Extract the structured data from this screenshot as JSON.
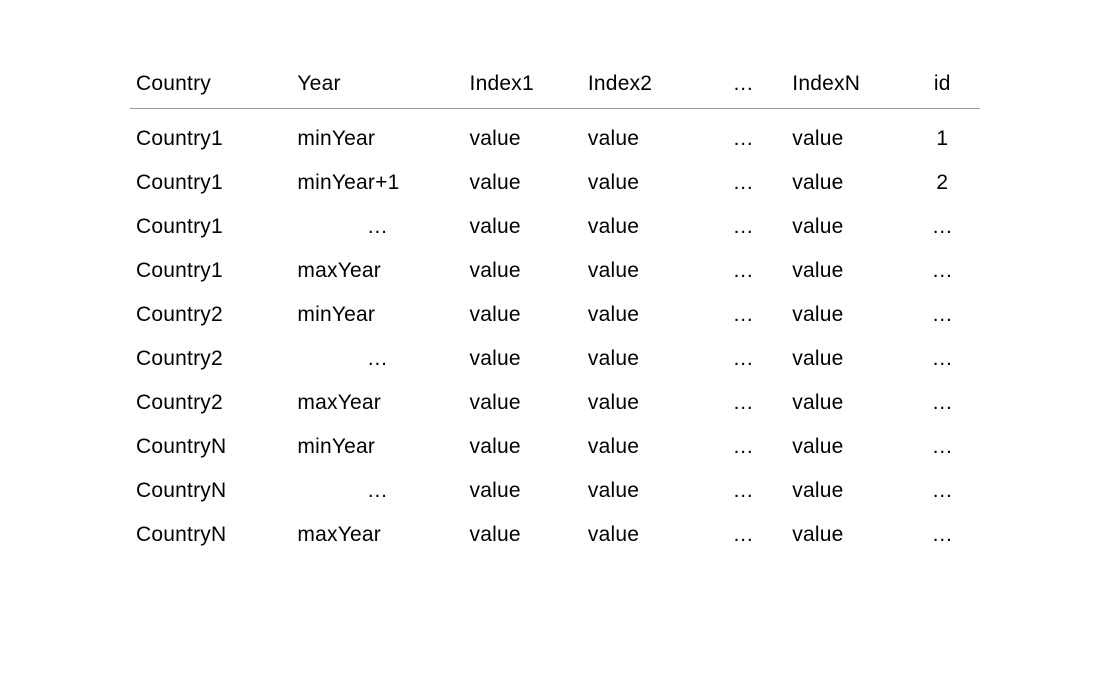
{
  "chart_data": {
    "type": "table",
    "headers": [
      "Country",
      "Year",
      "Index1",
      "Index2",
      "…",
      "IndexN",
      "id"
    ],
    "rows": [
      [
        "Country1",
        "minYear",
        "value",
        "value",
        "…",
        "value",
        "1"
      ],
      [
        "Country1",
        "minYear+1",
        "value",
        "value",
        "…",
        "value",
        "2"
      ],
      [
        "Country1",
        "…",
        "value",
        "value",
        "…",
        "value",
        "…"
      ],
      [
        "Country1",
        "maxYear",
        "value",
        "value",
        "…",
        "value",
        "…"
      ],
      [
        "Country2",
        "minYear",
        "value",
        "value",
        "…",
        "value",
        "…"
      ],
      [
        "Country2",
        "…",
        "value",
        "value",
        "…",
        "value",
        "…"
      ],
      [
        "Country2",
        "maxYear",
        "value",
        "value",
        "…",
        "value",
        "…"
      ],
      [
        "CountryN",
        "minYear",
        "value",
        "value",
        "…",
        "value",
        "…"
      ],
      [
        "CountryN",
        "…",
        "value",
        "value",
        "…",
        "value",
        "…"
      ],
      [
        "CountryN",
        "maxYear",
        "value",
        "value",
        "…",
        "value",
        "…"
      ]
    ]
  }
}
